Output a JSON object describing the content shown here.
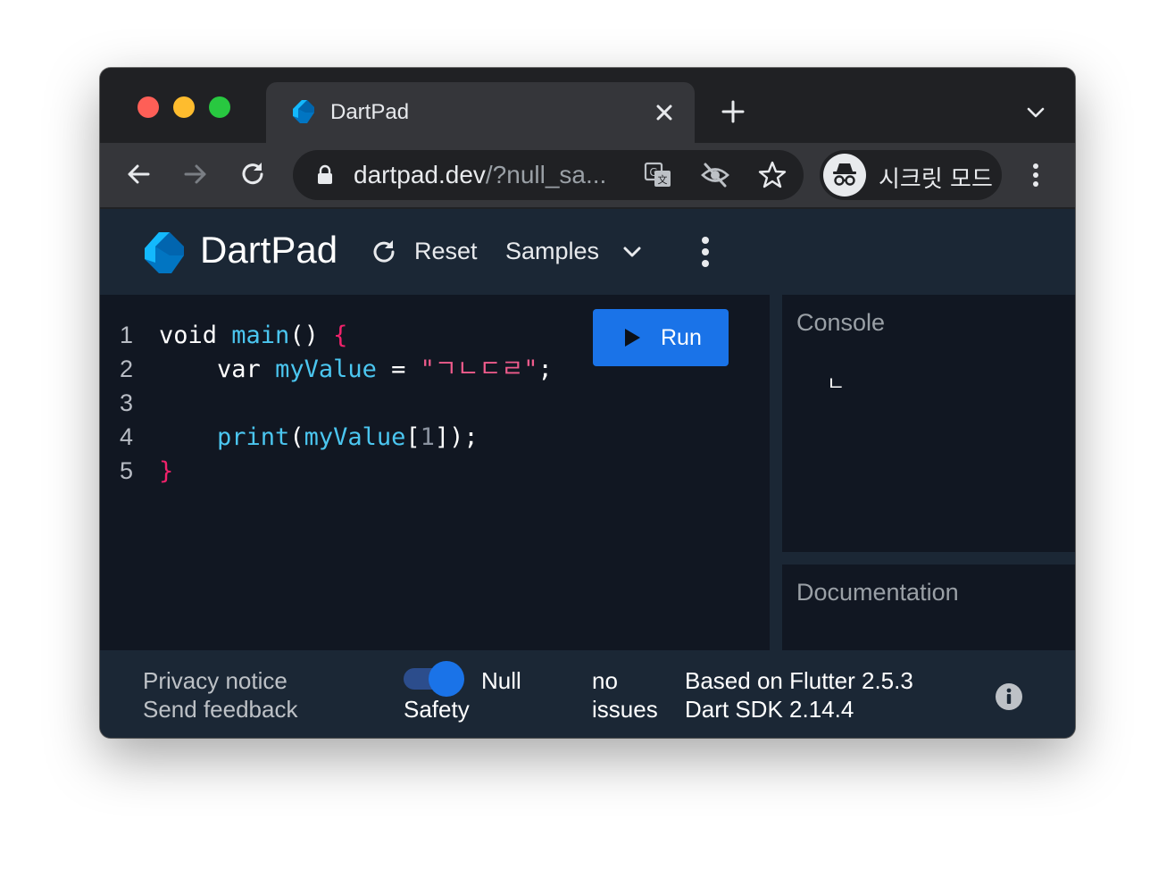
{
  "browser": {
    "tab_title": "DartPad",
    "url_host": "dartpad.dev",
    "url_rest": "/?null_sa...",
    "incognito_label": "시크릿 모드"
  },
  "icons": {
    "back": "arrow-left",
    "forward": "arrow-right",
    "reload": "refresh",
    "lock": "lock",
    "translate": "translate",
    "tracking": "eye-off",
    "bookmark": "star",
    "menu": "more-vertical",
    "info": "info"
  },
  "dartpad": {
    "title": "DartPad",
    "reset_label": "Reset",
    "samples_label": "Samples",
    "run_label": "Run",
    "code_lines": [
      {
        "num": "1",
        "t1": "void ",
        "fn": "main",
        "t2": "() ",
        "brace": "{"
      },
      {
        "num": "2",
        "indent": "    ",
        "kw": "var ",
        "ident": "myValue",
        "op": " = ",
        "str": "\"ㄱㄴㄷㄹ\"",
        "end": ";"
      },
      {
        "num": "3"
      },
      {
        "num": "4",
        "indent": "    ",
        "fn": "print",
        "p1": "(",
        "ident": "myValue",
        "p2": "[",
        "n": "1",
        "p3": "]);"
      },
      {
        "num": "5",
        "brace": "}"
      }
    ],
    "console_title": "Console",
    "console_output": "ㄴ",
    "documentation_title": "Documentation"
  },
  "footer": {
    "privacy_notice": "Privacy notice",
    "send_feedback": "Send feedback",
    "null_safety_line1": "Null",
    "null_safety_line2": "Safety",
    "null_safety_enabled": true,
    "issues_line1": "no",
    "issues_line2": "issues",
    "flutter_version": "Based on Flutter 2.5.3",
    "dart_sdk": "Dart SDK 2.14.4"
  },
  "colors": {
    "accent": "#1a73e8",
    "header_bg": "#1b2735",
    "editor_bg": "#111722",
    "code_function": "#4bc6f0",
    "code_string": "#ef5b8c",
    "code_brace": "#f0226b"
  }
}
